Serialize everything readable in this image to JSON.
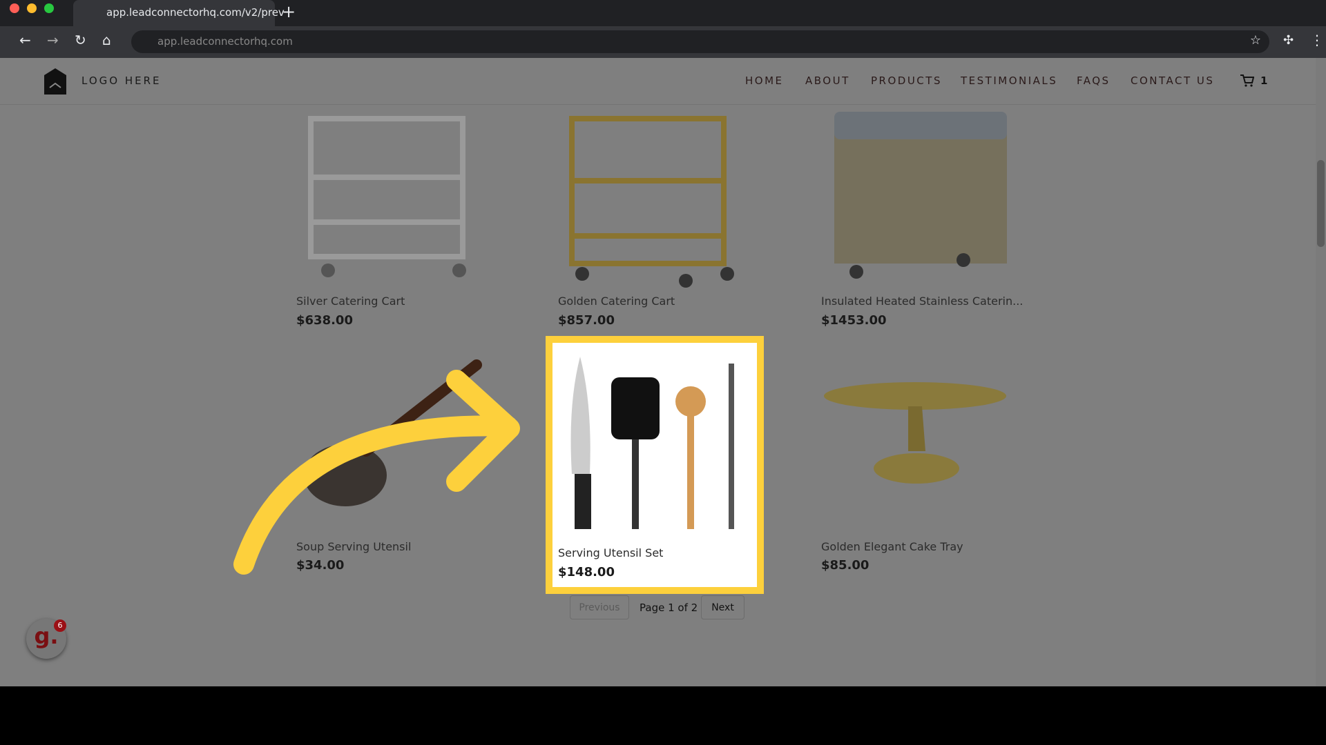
{
  "browser": {
    "tab_title": "app.leadconnectorhq.com/v2/prev",
    "url": "app.leadconnectorhq.com",
    "new_tab": "+"
  },
  "site": {
    "logo_text": "LOGO HERE",
    "nav": [
      "HOME",
      "ABOUT",
      "PRODUCTS",
      "TESTIMONIALS",
      "FAQS",
      "CONTACT US"
    ],
    "cart_count": "1"
  },
  "products": [
    {
      "name": "Silver Catering Cart",
      "price": "$638.00"
    },
    {
      "name": "Golden Catering Cart",
      "price": "$857.00"
    },
    {
      "name": "Insulated Heated Stainless Caterin...",
      "price": "$1453.00"
    },
    {
      "name": "Soup Serving Utensil",
      "price": "$34.00"
    },
    {
      "name": "Serving Utensil Set",
      "price": "$148.00"
    },
    {
      "name": "Golden Elegant Cake Tray",
      "price": "$85.00"
    }
  ],
  "pagination": {
    "previous": "Previous",
    "page": "Page 1 of 2",
    "next": "Next"
  },
  "widget": {
    "badge": "6",
    "letter": "g."
  },
  "colors": {
    "highlight": "#fdd03c",
    "overlay": "#7f7f7f"
  }
}
